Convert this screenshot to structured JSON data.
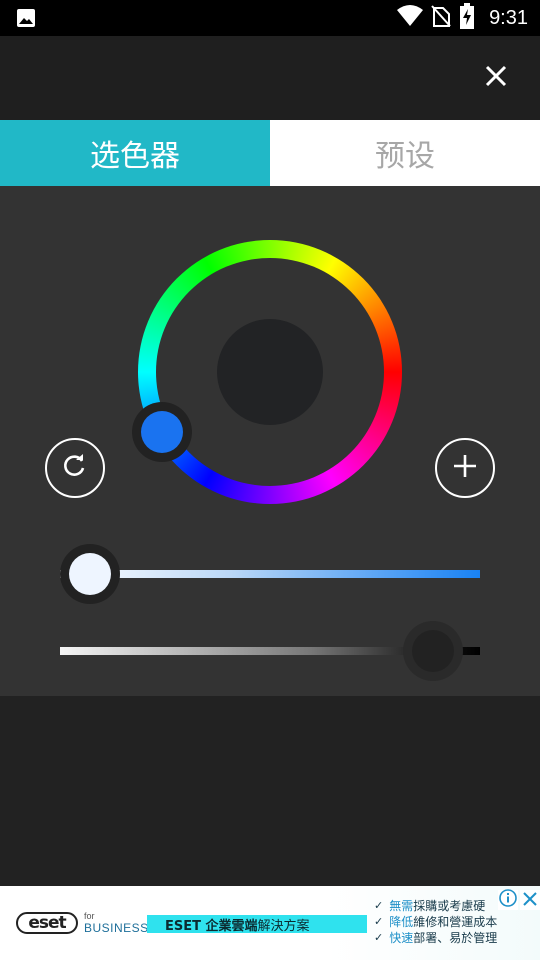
{
  "status_bar": {
    "time": "9:31",
    "icons": [
      "image-icon",
      "wifi-icon",
      "no-sim-icon",
      "battery-charging-icon"
    ]
  },
  "top_bar": {
    "close_icon": "close-icon"
  },
  "tabs": [
    {
      "label": "选色器",
      "active": true
    },
    {
      "label": "预设",
      "active": false
    }
  ],
  "picker": {
    "selected_color": "#1a73f0",
    "preview_color": "#222325",
    "reset_icon": "refresh-icon",
    "add_icon": "plus-icon",
    "saturation_level": 0.0,
    "brightness_level": 0.89
  },
  "colors": {
    "accent": "#21b8c7",
    "panel_bg": "#333333",
    "app_bg": "#222222"
  },
  "ad": {
    "brand_logo": "eset",
    "for_text": "for",
    "business_text": "BUSINESS",
    "headline_bold": "ESET 企業雲端",
    "headline_light": "解決方案",
    "bullets": [
      {
        "hl": "無需",
        "rest": "採購或考慮硬"
      },
      {
        "hl": "降低",
        "rest": "維修和營運成本"
      },
      {
        "hl": "快速",
        "rest": "部署、易於管理"
      }
    ],
    "info_icon": "info-icon",
    "close_icon": "close-icon"
  }
}
